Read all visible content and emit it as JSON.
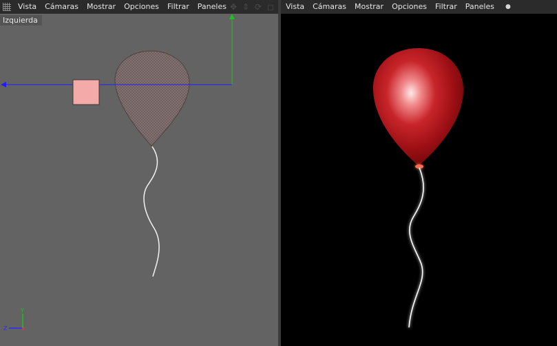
{
  "left_viewport": {
    "menu": [
      "Vista",
      "Cámaras",
      "Mostrar",
      "Opciones",
      "Filtrar",
      "Paneles"
    ],
    "view_label": "Izquierda",
    "axis_labels": {
      "y": "Y",
      "z": "Z"
    },
    "colors": {
      "background": "#636363",
      "x_axis": "#1c1cff",
      "y_axis": "#1fbf1f",
      "object_box": "#f3aaa8"
    }
  },
  "right_viewport": {
    "menu": [
      "Vista",
      "Cámaras",
      "Mostrar",
      "Opciones",
      "Filtrar",
      "Paneles"
    ],
    "colors": {
      "background": "#000000",
      "balloon": "#c0181c"
    }
  },
  "icons": [
    "grid-icon",
    "move-icon",
    "pan-icon",
    "rotate-icon",
    "maximize-icon",
    "more-dot-icon"
  ]
}
